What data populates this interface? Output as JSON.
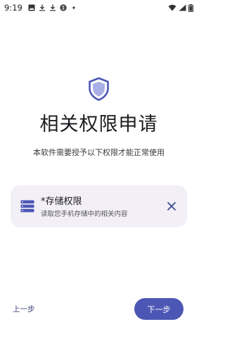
{
  "status_bar": {
    "time": "9:19",
    "left_icons": [
      "image-icon",
      "download-icon",
      "download-icon",
      "app-notification-icon",
      "dot-icon"
    ],
    "right_icons": [
      "wifi-icon",
      "signal-icon",
      "battery-icon"
    ]
  },
  "header": {
    "icon": "shield-icon",
    "title": "相关权限申请",
    "subtitle": "本软件需要授予以下权限才能正常使用"
  },
  "permissions": [
    {
      "icon": "storage-icon",
      "title": "*存储权限",
      "description": "读取您手机存储中的相关内容",
      "action_icon": "close-icon"
    }
  ],
  "footer": {
    "prev_label": "上一步",
    "next_label": "下一步"
  },
  "colors": {
    "accent": "#4c57b5",
    "card_bg": "#f2eff7",
    "shield": "#4c57b5"
  }
}
